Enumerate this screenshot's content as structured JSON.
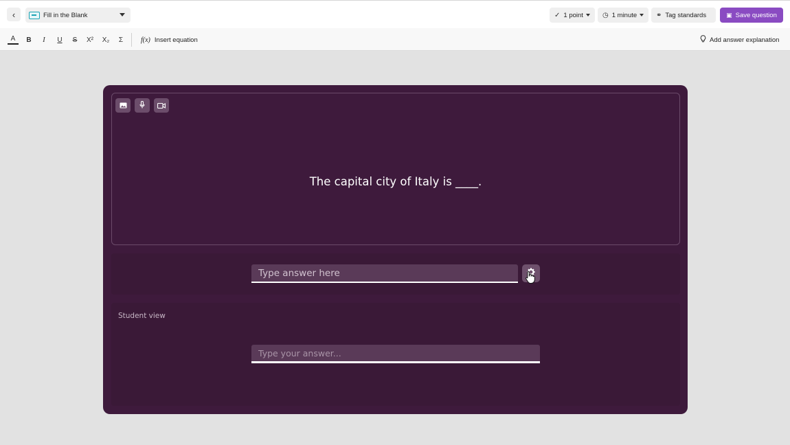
{
  "header": {
    "question_type": "Fill in the Blank",
    "points": "1 point",
    "time": "1 minute",
    "tag_label": "Tag standards",
    "save_label": "Save question"
  },
  "format_toolbar": {
    "color": "A",
    "bold": "B",
    "italic": "I",
    "underline": "U",
    "strike": "S",
    "superscript": "X²",
    "subscript": "X₂",
    "sum": "Σ",
    "equation_icon": "f(x)",
    "equation_label": "Insert equation",
    "explanation_label": "Add answer explanation"
  },
  "question": {
    "text": "The capital city of Italy is ____.",
    "media_buttons": [
      "image-icon",
      "mic-icon",
      "video-icon"
    ]
  },
  "answer": {
    "placeholder": "Type answer here"
  },
  "student_view": {
    "label": "Student view",
    "placeholder": "Type your answer..."
  },
  "colors": {
    "card": "#3e1a3c",
    "accent": "#8a4bc2",
    "type_icon": "#1aa3b3"
  }
}
